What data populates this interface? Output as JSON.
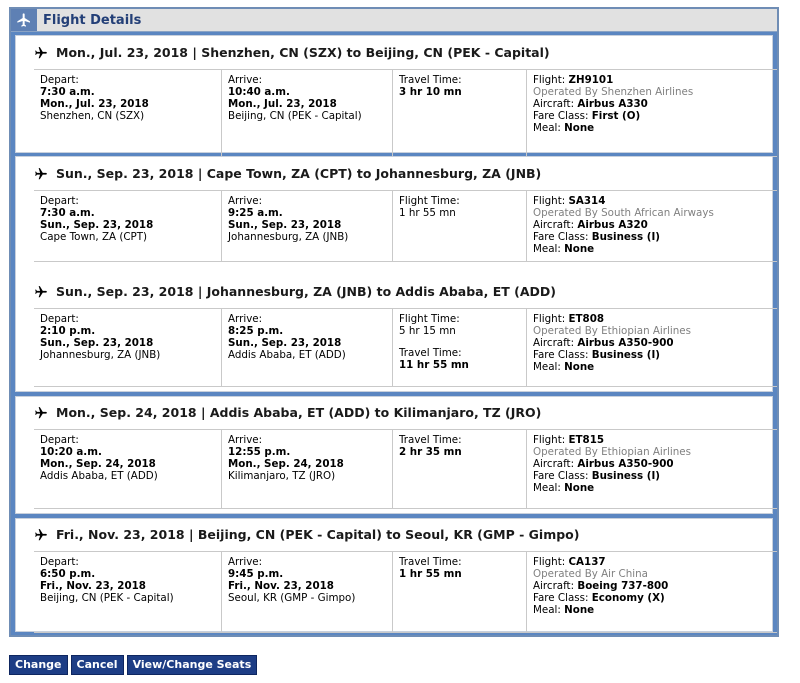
{
  "panel": {
    "title": "Flight Details"
  },
  "segments": [
    {
      "header": "Mon., Jul. 23, 2018 | Shenzhen, CN (SZX) to Beijing, CN (PEK - Capital)",
      "depart_label": "Depart:",
      "depart_time": "7:30 a.m.",
      "depart_date": "Mon., Jul. 23, 2018",
      "depart_city": "Shenzhen, CN (SZX)",
      "arrive_label": "Arrive:",
      "arrive_time": "10:40 a.m.",
      "arrive_date": "Mon., Jul. 23, 2018",
      "arrive_city": "Beijing, CN (PEK - Capital)",
      "time_label": "Travel Time:",
      "time_value": "3 hr 10 mn",
      "flight_label": "Flight:",
      "flight": "ZH9101",
      "operated_by": "Operated By Shenzhen Airlines",
      "aircraft_label": "Aircraft:",
      "aircraft": "Airbus A330",
      "fare_label": "Fare Class:",
      "fare": "First (O)",
      "meal_label": "Meal:",
      "meal": "None"
    },
    {
      "header": "Sun., Sep. 23, 2018 | Cape Town, ZA (CPT) to Johannesburg, ZA (JNB)",
      "depart_label": "Depart:",
      "depart_time": "7:30 a.m.",
      "depart_date": "Sun., Sep. 23, 2018",
      "depart_city": "Cape Town, ZA (CPT)",
      "arrive_label": "Arrive:",
      "arrive_time": "9:25 a.m.",
      "arrive_date": "Sun., Sep. 23, 2018",
      "arrive_city": "Johannesburg, ZA (JNB)",
      "time_label": "Flight Time:",
      "time_value": "1 hr 55 mn",
      "flight_label": "Flight:",
      "flight": "SA314",
      "operated_by": "Operated By South African Airways",
      "aircraft_label": "Aircraft:",
      "aircraft": "Airbus A320",
      "fare_label": "Fare Class:",
      "fare": "Business (I)",
      "meal_label": "Meal:",
      "meal": "None"
    },
    {
      "header": "Sun., Sep. 23, 2018 | Johannesburg, ZA (JNB) to Addis Ababa, ET (ADD)",
      "depart_label": "Depart:",
      "depart_time": "2:10 p.m.",
      "depart_date": "Sun., Sep. 23, 2018",
      "depart_city": "Johannesburg, ZA (JNB)",
      "arrive_label": "Arrive:",
      "arrive_time": "8:25 p.m.",
      "arrive_date": "Sun., Sep. 23, 2018",
      "arrive_city": "Addis Ababa, ET (ADD)",
      "time_label": "Flight Time:",
      "time_value": "5 hr 15 mn",
      "travel_label": "Travel Time:",
      "travel_value": "11 hr 55 mn",
      "flight_label": "Flight:",
      "flight": "ET808",
      "operated_by": "Operated By Ethiopian Airlines",
      "aircraft_label": "Aircraft:",
      "aircraft": "Airbus A350-900",
      "fare_label": "Fare Class:",
      "fare": "Business (I)",
      "meal_label": "Meal:",
      "meal": "None"
    },
    {
      "header": "Mon., Sep. 24, 2018 | Addis Ababa, ET (ADD) to Kilimanjaro, TZ (JRO)",
      "depart_label": "Depart:",
      "depart_time": "10:20 a.m.",
      "depart_date": "Mon., Sep. 24, 2018",
      "depart_city": "Addis Ababa, ET (ADD)",
      "arrive_label": "Arrive:",
      "arrive_time": "12:55 p.m.",
      "arrive_date": "Mon., Sep. 24, 2018",
      "arrive_city": "Kilimanjaro, TZ (JRO)",
      "time_label": "Travel Time:",
      "time_value": "2 hr 35 mn",
      "flight_label": "Flight:",
      "flight": "ET815",
      "operated_by": "Operated By Ethiopian Airlines",
      "aircraft_label": "Aircraft:",
      "aircraft": "Airbus A350-900",
      "fare_label": "Fare Class:",
      "fare": "Business (I)",
      "meal_label": "Meal:",
      "meal": "None"
    },
    {
      "header": "Fri., Nov. 23, 2018 | Beijing, CN (PEK - Capital) to Seoul, KR (GMP - Gimpo)",
      "depart_label": "Depart:",
      "depart_time": "6:50 p.m.",
      "depart_date": "Fri., Nov. 23, 2018",
      "depart_city": "Beijing, CN (PEK - Capital)",
      "arrive_label": "Arrive:",
      "arrive_time": "9:45 p.m.",
      "arrive_date": "Fri., Nov. 23, 2018",
      "arrive_city": "Seoul, KR (GMP - Gimpo)",
      "time_label": "Travel Time:",
      "time_value": "1 hr 55 mn",
      "flight_label": "Flight:",
      "flight": "CA137",
      "operated_by": "Operated By Air China",
      "aircraft_label": "Aircraft:",
      "aircraft": "Boeing 737-800",
      "fare_label": "Fare Class:",
      "fare": "Economy (X)",
      "meal_label": "Meal:",
      "meal": "None"
    }
  ],
  "buttons": {
    "change": "Change",
    "cancel": "Cancel",
    "seats": "View/Change Seats"
  }
}
